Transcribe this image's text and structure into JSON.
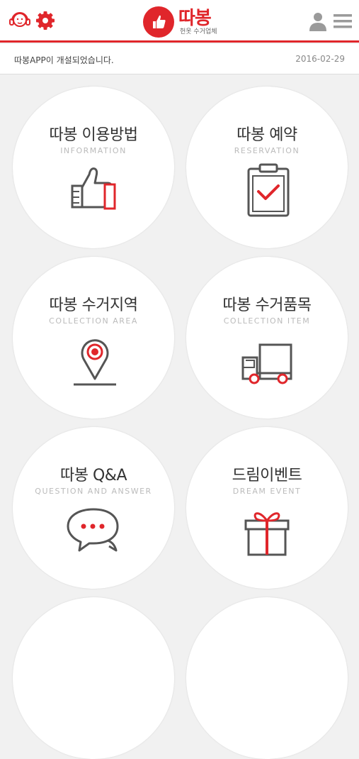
{
  "header": {
    "logo_text": "따봉",
    "logo_sub": "헌옷 수거업체"
  },
  "notice": {
    "text": "따봉APP이 개설되었습니다.",
    "date": "2016-02-29"
  },
  "menu": [
    {
      "title": "따봉 이용방법",
      "subtitle": "INFORMATION",
      "icon": "thumbs-up-icon"
    },
    {
      "title": "따봉 예약",
      "subtitle": "RESERVATION",
      "icon": "clipboard-check-icon"
    },
    {
      "title": "따봉 수거지역",
      "subtitle": "COLLECTION AREA",
      "icon": "map-pin-icon"
    },
    {
      "title": "따봉 수거품목",
      "subtitle": "COLLECTION ITEM",
      "icon": "truck-icon"
    },
    {
      "title": "따봉 Q&A",
      "subtitle": "QUESTION AND ANSWER",
      "icon": "chat-bubble-icon"
    },
    {
      "title": "드림이벤트",
      "subtitle": "DREAM EVENT",
      "icon": "gift-icon"
    }
  ],
  "colors": {
    "accent": "#e0262b",
    "icon_gray": "#555555"
  }
}
